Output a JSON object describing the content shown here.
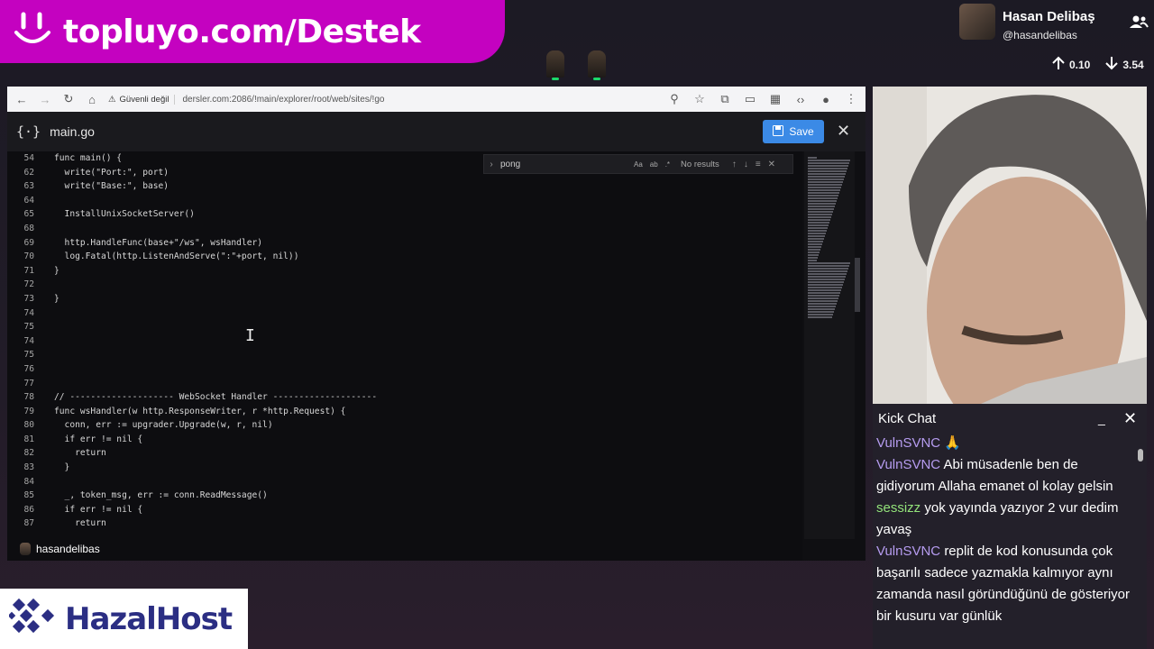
{
  "banner": {
    "text": "topluyo.com/Destek"
  },
  "profile": {
    "name": "Hasan Delibaş",
    "handle": "@hasandelibas",
    "upload": "0.10",
    "download": "3.54"
  },
  "browser": {
    "security_label": "Güvenli değil",
    "url": "dersler.com:2086/!main/explorer/root/web/sites/!go"
  },
  "editor": {
    "file_name": "main.go",
    "save_label": "Save",
    "find": {
      "query": "pong",
      "result": "No results"
    },
    "lines": [
      {
        "n": "54",
        "code": "func main() {"
      },
      {
        "n": "62",
        "code": "  write(\"Port:\", port)"
      },
      {
        "n": "63",
        "code": "  write(\"Base:\", base)"
      },
      {
        "n": "64",
        "code": ""
      },
      {
        "n": "65",
        "code": "  InstallUnixSocketServer()"
      },
      {
        "n": "68",
        "code": ""
      },
      {
        "n": "69",
        "code": "  http.HandleFunc(base+\"/ws\", wsHandler)"
      },
      {
        "n": "70",
        "code": "  log.Fatal(http.ListenAndServe(\":\"+port, nil))"
      },
      {
        "n": "71",
        "code": "}"
      },
      {
        "n": "72",
        "code": ""
      },
      {
        "n": "73",
        "code": "}"
      },
      {
        "n": "74",
        "code": ""
      },
      {
        "n": "75",
        "code": ""
      },
      {
        "n": "74",
        "code": ""
      },
      {
        "n": "75",
        "code": ""
      },
      {
        "n": "76",
        "code": ""
      },
      {
        "n": "77",
        "code": ""
      },
      {
        "n": "78",
        "code": "// -------------------- WebSocket Handler --------------------"
      },
      {
        "n": "79",
        "code": "func wsHandler(w http.ResponseWriter, r *http.Request) {"
      },
      {
        "n": "80",
        "code": "  conn, err := upgrader.Upgrade(w, r, nil)"
      },
      {
        "n": "81",
        "code": "  if err != nil {"
      },
      {
        "n": "82",
        "code": "    return"
      },
      {
        "n": "83",
        "code": "  }"
      },
      {
        "n": "84",
        "code": ""
      },
      {
        "n": "85",
        "code": "  _, token_msg, err := conn.ReadMessage()"
      },
      {
        "n": "86",
        "code": "  if err != nil {"
      },
      {
        "n": "87",
        "code": "    return"
      }
    ]
  },
  "stream_user": "hasandelibas",
  "chat": {
    "title": "Kick Chat",
    "messages": [
      {
        "user": "VulnSVNC",
        "text": "🙏",
        "color": "purple"
      },
      {
        "user": "VulnSVNC",
        "text": "Abi müsadenle ben de gidiyorum Allaha emanet ol kolay gelsin",
        "color": "purple"
      },
      {
        "user": "sessizz",
        "text": "yok yayında yazıyor 2 vur dedim yavaş",
        "color": "green"
      },
      {
        "user": "VulnSVNC",
        "text": "replit de kod konusunda çok başarılı sadece yazmakla kalmıyor aynı zamanda nasıl göründüğünü de gösteriyor bir kusuru var günlük",
        "color": "purple"
      }
    ]
  },
  "sponsor": {
    "text": "HazalHost"
  },
  "colors": {
    "banner": "#c402c0",
    "save": "#3b8ae6",
    "chat_user": "#b69cf0",
    "chat_user_green": "#93e37a",
    "sponsor": "#2b2e83"
  }
}
